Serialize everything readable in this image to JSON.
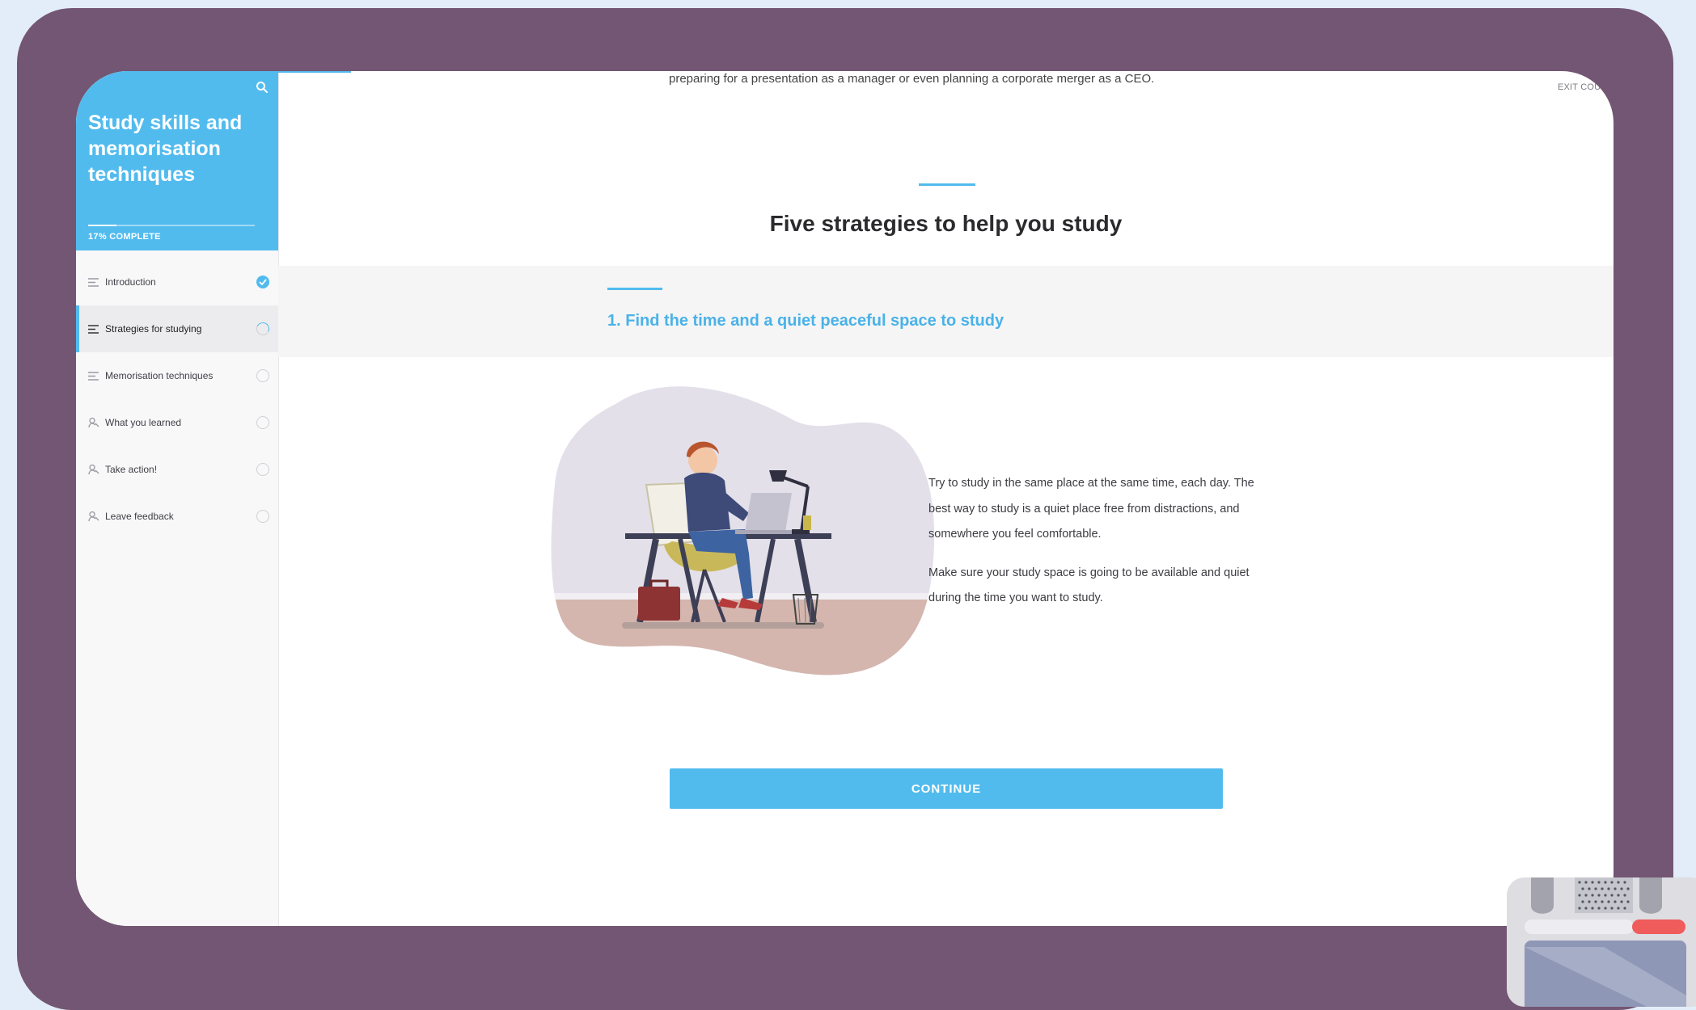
{
  "sidebar": {
    "course_title": "Study skills and memorisation techniques",
    "progress_percent": 17,
    "progress_label": "17% COMPLETE",
    "search_icon": "search-icon",
    "lessons": [
      {
        "label": "Introduction",
        "status": "done",
        "icon": "lines-icon"
      },
      {
        "label": "Strategies for studying",
        "status": "in-progress",
        "icon": "lines-icon"
      },
      {
        "label": "Memorisation techniques",
        "status": "todo",
        "icon": "lines-icon"
      },
      {
        "label": "What you learned",
        "status": "todo",
        "icon": "scenario-icon"
      },
      {
        "label": "Take action!",
        "status": "todo",
        "icon": "scenario-icon"
      },
      {
        "label": "Leave feedback",
        "status": "todo",
        "icon": "scenario-icon"
      }
    ]
  },
  "main": {
    "exit_label": "EXIT COURS",
    "previous_text": "preparing for a presentation as a manager or even planning a corporate merger as a CEO.",
    "heading": "Five strategies to help you study",
    "subheading": "1. Find the time and a quiet peaceful space to study",
    "paragraphs": [
      "Try to study in the same place at the same time, each day. The best way to study is a quiet place free from distractions, and somewhere you feel comfortable.",
      "Make sure your study space is going to be available and quiet during the time you want to study."
    ],
    "continue_label": "CONTINUE"
  },
  "colors": {
    "accent": "#52bbee",
    "frame": "#735673",
    "background": "#e3edf9"
  }
}
